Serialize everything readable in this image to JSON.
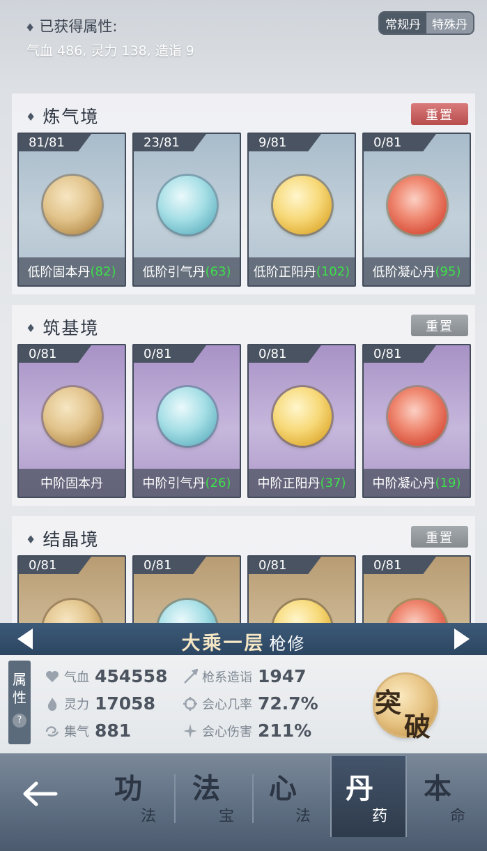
{
  "header": {
    "obtained_label": "已获得属性:",
    "obtained_stats": "气血 486, 灵力 138, 造诣 9",
    "toggle": {
      "normal": "常规丹",
      "special": "特殊丹"
    }
  },
  "sections": [
    {
      "title": "炼气境",
      "reset": "重置",
      "cards": [
        {
          "count": "81/81",
          "name": "低阶固本丹",
          "level": "(82)"
        },
        {
          "count": "23/81",
          "name": "低阶引气丹",
          "level": "(63)"
        },
        {
          "count": "9/81",
          "name": "低阶正阳丹",
          "level": "(102)"
        },
        {
          "count": "0/81",
          "name": "低阶凝心丹",
          "level": "(95)"
        }
      ]
    },
    {
      "title": "筑基境",
      "reset": "重置",
      "cards": [
        {
          "count": "0/81",
          "name": "中阶固本丹",
          "level": ""
        },
        {
          "count": "0/81",
          "name": "中阶引气丹",
          "level": "(26)"
        },
        {
          "count": "0/81",
          "name": "中阶正阳丹",
          "level": "(37)"
        },
        {
          "count": "0/81",
          "name": "中阶凝心丹",
          "level": "(19)"
        }
      ]
    },
    {
      "title": "结晶境",
      "reset": "重置",
      "cards": [
        {
          "count": "0/81"
        },
        {
          "count": "0/81"
        },
        {
          "count": "0/81"
        },
        {
          "count": "0/81"
        }
      ]
    }
  ],
  "character": {
    "realm": "大乘一层",
    "class": "枪修"
  },
  "attributes": {
    "tab_label_1": "属",
    "tab_label_2": "性",
    "help": "?",
    "hp_label": "气血",
    "hp": "454558",
    "spirit_label": "灵力",
    "spirit": "17058",
    "focus_label": "集气",
    "focus": "881",
    "mastery_label": "枪系造诣",
    "mastery": "1947",
    "crit_rate_label": "会心几率",
    "crit_rate": "72.7%",
    "crit_dmg_label": "会心伤害",
    "crit_dmg": "211%"
  },
  "breakthrough": {
    "c1": "突",
    "c2": "破"
  },
  "nav": {
    "tabs": [
      {
        "big": "功",
        "small": "法"
      },
      {
        "big": "法",
        "small": "宝"
      },
      {
        "big": "心",
        "small": "法"
      },
      {
        "big": "丹",
        "small": "药"
      },
      {
        "big": "本",
        "small": "命"
      }
    ]
  },
  "colors": {
    "accent_green": "#3de04a",
    "reset_red": "#c65c5c",
    "level_bar": "#34506d"
  }
}
